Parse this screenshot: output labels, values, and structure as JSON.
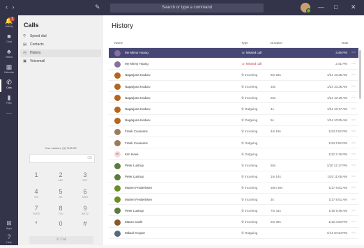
{
  "titlebar": {
    "nav_back": "‹",
    "nav_forward": "›",
    "search_placeholder": "Search or type a command",
    "win_min": "—",
    "win_max": "□",
    "win_close": "✕"
  },
  "rail": [
    {
      "icon": "activity-icon",
      "glyph": "🔔",
      "label": "Activity",
      "badge": "1"
    },
    {
      "icon": "chat-icon",
      "glyph": "■",
      "label": "Chat"
    },
    {
      "icon": "teams-icon",
      "glyph": "♣",
      "label": "Teams"
    },
    {
      "icon": "calendar-icon",
      "glyph": "▦",
      "label": "Calendar"
    },
    {
      "icon": "calls-icon",
      "glyph": "✆",
      "label": "Calls",
      "active": true
    },
    {
      "icon": "files-icon",
      "glyph": "▮",
      "label": "Files"
    },
    {
      "icon": "more-icon",
      "glyph": "⋯",
      "label": ""
    }
  ],
  "rail_bottom": [
    {
      "icon": "apps-icon",
      "glyph": "⊞",
      "label": "Apps"
    },
    {
      "icon": "help-icon",
      "glyph": "?",
      "label": "Help"
    }
  ],
  "calls_panel": {
    "title": "Calls",
    "nav": [
      {
        "icon": "speed-dial-icon",
        "glyph": "⚲",
        "label": "Speed dial"
      },
      {
        "icon": "contacts-icon",
        "glyph": "▤",
        "label": "Contacts"
      },
      {
        "icon": "history-icon",
        "glyph": "◷",
        "label": "History",
        "active": true
      },
      {
        "icon": "voicemail-icon",
        "glyph": "▣",
        "label": "Voicemail"
      }
    ],
    "your_number": "Your number: (4) 7135 52",
    "keypad": [
      {
        "d": "1",
        "s": ""
      },
      {
        "d": "2",
        "s": "ABC"
      },
      {
        "d": "3",
        "s": "DEF"
      },
      {
        "d": "4",
        "s": "GHI"
      },
      {
        "d": "5",
        "s": "JKL"
      },
      {
        "d": "6",
        "s": "MNO"
      },
      {
        "d": "7",
        "s": "PQRS"
      },
      {
        "d": "8",
        "s": "TUV"
      },
      {
        "d": "9",
        "s": "WXYZ"
      },
      {
        "d": "*",
        "s": ""
      },
      {
        "d": "0",
        "s": "+"
      },
      {
        "d": "#",
        "s": ""
      }
    ],
    "call_label": "✆  Call"
  },
  "history": {
    "title": "History",
    "columns": {
      "name": "Name",
      "type": "Type",
      "duration": "Duration",
      "date": "Date"
    },
    "rows": [
      {
        "name": "My Minny Hoang",
        "type": "Missed call",
        "missed": true,
        "duration": "",
        "date": "3:46 PM",
        "avatar": "#8a6f9e",
        "selected": true
      },
      {
        "name": "My Minny Hoang",
        "type": "Missed call",
        "missed": true,
        "duration": "",
        "date": "2:41 PM",
        "avatar": "#8a6f9e"
      },
      {
        "name": "Nagarjuna Koduru",
        "type": "Incoming",
        "duration": "6m 53s",
        "date": "1/24 10:28 AM",
        "avatar": "#b5651d"
      },
      {
        "name": "Nagarjuna Koduru",
        "type": "Incoming",
        "duration": "34s",
        "date": "1/24 10:26 AM",
        "avatar": "#b5651d"
      },
      {
        "name": "Nagarjuna Koduru",
        "type": "Incoming",
        "duration": "25s",
        "date": "1/24 10:19 AM",
        "avatar": "#b5651d"
      },
      {
        "name": "Nagarjuna Koduru",
        "type": "Outgoing",
        "duration": "4s",
        "date": "1/24 10:17 AM",
        "avatar": "#b5651d"
      },
      {
        "name": "Nagarjuna Koduru",
        "type": "Outgoing",
        "duration": "5s",
        "date": "1/24 10:05 AM",
        "avatar": "#b5651d"
      },
      {
        "name": "Frank Coussens",
        "type": "Incoming",
        "duration": "4m 19s",
        "date": "1/23 4:52 PM",
        "avatar": "#9c7a5b"
      },
      {
        "name": "Frank Coussens",
        "type": "Outgoing",
        "duration": "",
        "date": "1/23 4:52 PM",
        "avatar": "#9c7a5b"
      },
      {
        "name": "Kim Have",
        "initials": "KH",
        "type": "Outgoing",
        "duration": "",
        "date": "1/22 2:15 PM",
        "avatar": "#f6dbe0"
      },
      {
        "name": "Peter Lustrup",
        "type": "Incoming",
        "duration": "55s",
        "date": "1/20 12:17 PM",
        "avatar": "#5a7d3c"
      },
      {
        "name": "Peter Lustrup",
        "type": "Incoming",
        "duration": "1m 14s",
        "date": "1/20 11:08 AM",
        "avatar": "#5a7d3c"
      },
      {
        "name": "Morten Frederiksen",
        "type": "Incoming",
        "duration": "26m 30s",
        "date": "1/17 8:51 AM",
        "avatar": "#6b8e23"
      },
      {
        "name": "Morten Frederiksen",
        "type": "Incoming",
        "duration": "3s",
        "date": "1/17 8:51 AM",
        "avatar": "#6b8e23"
      },
      {
        "name": "Peter Lustrup",
        "type": "Incoming",
        "duration": "7m 31s",
        "date": "1/16 9:49 AM",
        "avatar": "#5a7d3c"
      },
      {
        "name": "Mauro Cavle",
        "type": "Incoming",
        "duration": "2m 39s",
        "date": "1/15 3:00 PM",
        "avatar": "#8b5a2b"
      },
      {
        "name": "Mikael Cropier",
        "type": "Outgoing",
        "duration": "",
        "date": "1/14 10:34 PM",
        "avatar": "#556b7d"
      }
    ]
  }
}
